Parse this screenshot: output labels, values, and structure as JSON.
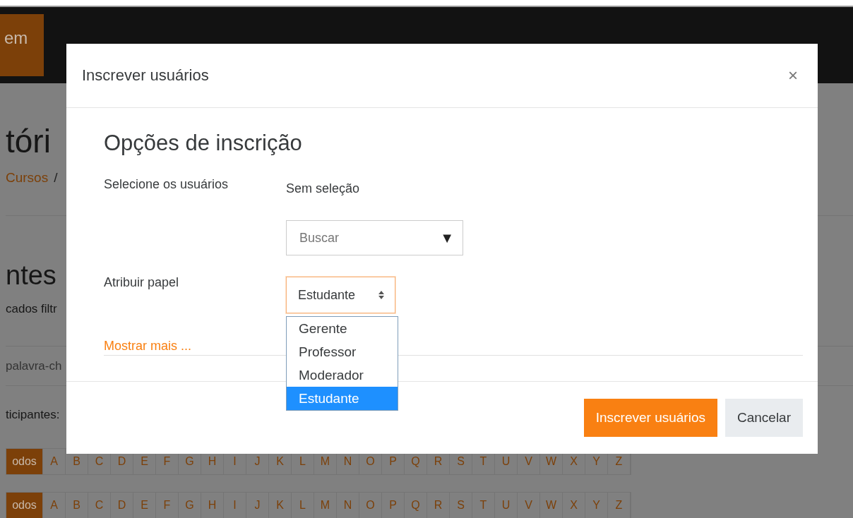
{
  "navbar": {
    "button": "em"
  },
  "page": {
    "title": "tóri",
    "breadcrumb": "Cursos",
    "breadcrumb_separator": "/",
    "section_title": "ntes",
    "filter_text": "cados filtr",
    "search_placeholder": "palavra-ch",
    "participants_label": "ticipantes:",
    "letter_bars": [
      {
        "items": [
          {
            "label": "odos",
            "selected": true
          },
          {
            "label": "A",
            "selected": false
          },
          {
            "label": "B",
            "selected": false
          },
          {
            "label": "C",
            "selected": false
          },
          {
            "label": "D",
            "selected": false
          },
          {
            "label": "E",
            "selected": false
          },
          {
            "label": "F",
            "selected": false
          },
          {
            "label": "G",
            "selected": false
          },
          {
            "label": "H",
            "selected": false
          },
          {
            "label": "I",
            "selected": false
          },
          {
            "label": "J",
            "selected": false
          },
          {
            "label": "K",
            "selected": false
          },
          {
            "label": "L",
            "selected": false
          },
          {
            "label": "M",
            "selected": false
          },
          {
            "label": "N",
            "selected": false
          },
          {
            "label": "O",
            "selected": false
          },
          {
            "label": "P",
            "selected": false
          },
          {
            "label": "Q",
            "selected": false
          },
          {
            "label": "R",
            "selected": false
          },
          {
            "label": "S",
            "selected": false
          },
          {
            "label": "T",
            "selected": false
          },
          {
            "label": "U",
            "selected": false
          },
          {
            "label": "V",
            "selected": false
          },
          {
            "label": "W",
            "selected": false
          },
          {
            "label": "X",
            "selected": false
          },
          {
            "label": "Y",
            "selected": false
          },
          {
            "label": "Z",
            "selected": false
          }
        ]
      },
      {
        "items": [
          {
            "label": "odos",
            "selected": true
          },
          {
            "label": "A",
            "selected": false
          },
          {
            "label": "B",
            "selected": false
          },
          {
            "label": "C",
            "selected": false
          },
          {
            "label": "D",
            "selected": false
          },
          {
            "label": "E",
            "selected": false
          },
          {
            "label": "F",
            "selected": false
          },
          {
            "label": "G",
            "selected": false
          },
          {
            "label": "H",
            "selected": false
          },
          {
            "label": "I",
            "selected": false
          },
          {
            "label": "J",
            "selected": false
          },
          {
            "label": "K",
            "selected": false
          },
          {
            "label": "L",
            "selected": false
          },
          {
            "label": "M",
            "selected": false
          },
          {
            "label": "N",
            "selected": false
          },
          {
            "label": "O",
            "selected": false
          },
          {
            "label": "P",
            "selected": false
          },
          {
            "label": "Q",
            "selected": false
          },
          {
            "label": "R",
            "selected": false
          },
          {
            "label": "S",
            "selected": false
          },
          {
            "label": "T",
            "selected": false
          },
          {
            "label": "U",
            "selected": false
          },
          {
            "label": "V",
            "selected": false
          },
          {
            "label": "W",
            "selected": false
          },
          {
            "label": "X",
            "selected": false
          },
          {
            "label": "Y",
            "selected": false
          },
          {
            "label": "Z",
            "selected": false
          }
        ]
      }
    ]
  },
  "modal": {
    "title": "Inscrever usuários",
    "close": "×",
    "heading": "Opções de inscrição",
    "fields": [
      {
        "kind": "autocomplete",
        "label": "Selecione os usuários",
        "value": "Sem seleção",
        "placeholder": "Buscar",
        "arrow": "▼"
      },
      {
        "kind": "select",
        "label": "Atribuir papel",
        "value": "Estudante",
        "expanded": true,
        "options": [
          {
            "label": "Gerente",
            "selected": false
          },
          {
            "label": "Professor",
            "selected": false
          },
          {
            "label": "Moderador",
            "selected": false
          },
          {
            "label": "Estudante",
            "selected": true
          }
        ]
      }
    ],
    "link": "Mostrar mais ...",
    "buttons": [
      {
        "label": "Inscrever usuários",
        "kind": "primary"
      },
      {
        "label": "Cancelar",
        "kind": "secondary"
      }
    ]
  }
}
